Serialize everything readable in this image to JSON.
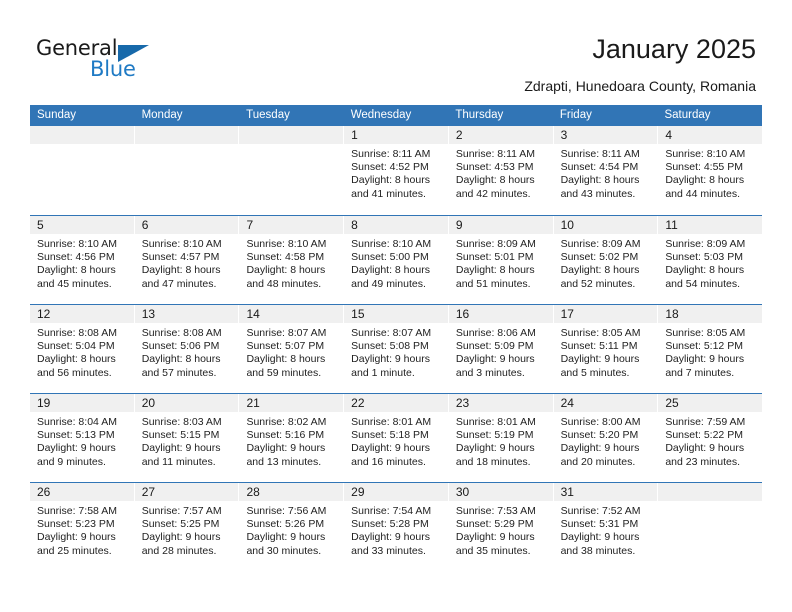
{
  "brand": {
    "name_top": "General",
    "name_bottom": "Blue"
  },
  "header": {
    "title": "January 2025",
    "location": "Zdrapti, Hunedoara County, Romania"
  },
  "colors": {
    "header_blue": "#3175b6",
    "daynum_gray": "#f0f0f0",
    "logo_blue": "#1f7ac4"
  },
  "weekdays": [
    "Sunday",
    "Monday",
    "Tuesday",
    "Wednesday",
    "Thursday",
    "Friday",
    "Saturday"
  ],
  "weeks": [
    [
      {
        "day": "",
        "empty": true
      },
      {
        "day": "",
        "empty": true
      },
      {
        "day": "",
        "empty": true
      },
      {
        "day": "1",
        "sunrise": "Sunrise: 8:11 AM",
        "sunset": "Sunset: 4:52 PM",
        "daylight1": "Daylight: 8 hours",
        "daylight2": "and 41 minutes."
      },
      {
        "day": "2",
        "sunrise": "Sunrise: 8:11 AM",
        "sunset": "Sunset: 4:53 PM",
        "daylight1": "Daylight: 8 hours",
        "daylight2": "and 42 minutes."
      },
      {
        "day": "3",
        "sunrise": "Sunrise: 8:11 AM",
        "sunset": "Sunset: 4:54 PM",
        "daylight1": "Daylight: 8 hours",
        "daylight2": "and 43 minutes."
      },
      {
        "day": "4",
        "sunrise": "Sunrise: 8:10 AM",
        "sunset": "Sunset: 4:55 PM",
        "daylight1": "Daylight: 8 hours",
        "daylight2": "and 44 minutes."
      }
    ],
    [
      {
        "day": "5",
        "sunrise": "Sunrise: 8:10 AM",
        "sunset": "Sunset: 4:56 PM",
        "daylight1": "Daylight: 8 hours",
        "daylight2": "and 45 minutes."
      },
      {
        "day": "6",
        "sunrise": "Sunrise: 8:10 AM",
        "sunset": "Sunset: 4:57 PM",
        "daylight1": "Daylight: 8 hours",
        "daylight2": "and 47 minutes."
      },
      {
        "day": "7",
        "sunrise": "Sunrise: 8:10 AM",
        "sunset": "Sunset: 4:58 PM",
        "daylight1": "Daylight: 8 hours",
        "daylight2": "and 48 minutes."
      },
      {
        "day": "8",
        "sunrise": "Sunrise: 8:10 AM",
        "sunset": "Sunset: 5:00 PM",
        "daylight1": "Daylight: 8 hours",
        "daylight2": "and 49 minutes."
      },
      {
        "day": "9",
        "sunrise": "Sunrise: 8:09 AM",
        "sunset": "Sunset: 5:01 PM",
        "daylight1": "Daylight: 8 hours",
        "daylight2": "and 51 minutes."
      },
      {
        "day": "10",
        "sunrise": "Sunrise: 8:09 AM",
        "sunset": "Sunset: 5:02 PM",
        "daylight1": "Daylight: 8 hours",
        "daylight2": "and 52 minutes."
      },
      {
        "day": "11",
        "sunrise": "Sunrise: 8:09 AM",
        "sunset": "Sunset: 5:03 PM",
        "daylight1": "Daylight: 8 hours",
        "daylight2": "and 54 minutes."
      }
    ],
    [
      {
        "day": "12",
        "sunrise": "Sunrise: 8:08 AM",
        "sunset": "Sunset: 5:04 PM",
        "daylight1": "Daylight: 8 hours",
        "daylight2": "and 56 minutes."
      },
      {
        "day": "13",
        "sunrise": "Sunrise: 8:08 AM",
        "sunset": "Sunset: 5:06 PM",
        "daylight1": "Daylight: 8 hours",
        "daylight2": "and 57 minutes."
      },
      {
        "day": "14",
        "sunrise": "Sunrise: 8:07 AM",
        "sunset": "Sunset: 5:07 PM",
        "daylight1": "Daylight: 8 hours",
        "daylight2": "and 59 minutes."
      },
      {
        "day": "15",
        "sunrise": "Sunrise: 8:07 AM",
        "sunset": "Sunset: 5:08 PM",
        "daylight1": "Daylight: 9 hours",
        "daylight2": "and 1 minute."
      },
      {
        "day": "16",
        "sunrise": "Sunrise: 8:06 AM",
        "sunset": "Sunset: 5:09 PM",
        "daylight1": "Daylight: 9 hours",
        "daylight2": "and 3 minutes."
      },
      {
        "day": "17",
        "sunrise": "Sunrise: 8:05 AM",
        "sunset": "Sunset: 5:11 PM",
        "daylight1": "Daylight: 9 hours",
        "daylight2": "and 5 minutes."
      },
      {
        "day": "18",
        "sunrise": "Sunrise: 8:05 AM",
        "sunset": "Sunset: 5:12 PM",
        "daylight1": "Daylight: 9 hours",
        "daylight2": "and 7 minutes."
      }
    ],
    [
      {
        "day": "19",
        "sunrise": "Sunrise: 8:04 AM",
        "sunset": "Sunset: 5:13 PM",
        "daylight1": "Daylight: 9 hours",
        "daylight2": "and 9 minutes."
      },
      {
        "day": "20",
        "sunrise": "Sunrise: 8:03 AM",
        "sunset": "Sunset: 5:15 PM",
        "daylight1": "Daylight: 9 hours",
        "daylight2": "and 11 minutes."
      },
      {
        "day": "21",
        "sunrise": "Sunrise: 8:02 AM",
        "sunset": "Sunset: 5:16 PM",
        "daylight1": "Daylight: 9 hours",
        "daylight2": "and 13 minutes."
      },
      {
        "day": "22",
        "sunrise": "Sunrise: 8:01 AM",
        "sunset": "Sunset: 5:18 PM",
        "daylight1": "Daylight: 9 hours",
        "daylight2": "and 16 minutes."
      },
      {
        "day": "23",
        "sunrise": "Sunrise: 8:01 AM",
        "sunset": "Sunset: 5:19 PM",
        "daylight1": "Daylight: 9 hours",
        "daylight2": "and 18 minutes."
      },
      {
        "day": "24",
        "sunrise": "Sunrise: 8:00 AM",
        "sunset": "Sunset: 5:20 PM",
        "daylight1": "Daylight: 9 hours",
        "daylight2": "and 20 minutes."
      },
      {
        "day": "25",
        "sunrise": "Sunrise: 7:59 AM",
        "sunset": "Sunset: 5:22 PM",
        "daylight1": "Daylight: 9 hours",
        "daylight2": "and 23 minutes."
      }
    ],
    [
      {
        "day": "26",
        "sunrise": "Sunrise: 7:58 AM",
        "sunset": "Sunset: 5:23 PM",
        "daylight1": "Daylight: 9 hours",
        "daylight2": "and 25 minutes."
      },
      {
        "day": "27",
        "sunrise": "Sunrise: 7:57 AM",
        "sunset": "Sunset: 5:25 PM",
        "daylight1": "Daylight: 9 hours",
        "daylight2": "and 28 minutes."
      },
      {
        "day": "28",
        "sunrise": "Sunrise: 7:56 AM",
        "sunset": "Sunset: 5:26 PM",
        "daylight1": "Daylight: 9 hours",
        "daylight2": "and 30 minutes."
      },
      {
        "day": "29",
        "sunrise": "Sunrise: 7:54 AM",
        "sunset": "Sunset: 5:28 PM",
        "daylight1": "Daylight: 9 hours",
        "daylight2": "and 33 minutes."
      },
      {
        "day": "30",
        "sunrise": "Sunrise: 7:53 AM",
        "sunset": "Sunset: 5:29 PM",
        "daylight1": "Daylight: 9 hours",
        "daylight2": "and 35 minutes."
      },
      {
        "day": "31",
        "sunrise": "Sunrise: 7:52 AM",
        "sunset": "Sunset: 5:31 PM",
        "daylight1": "Daylight: 9 hours",
        "daylight2": "and 38 minutes."
      },
      {
        "day": "",
        "empty": true
      }
    ]
  ]
}
